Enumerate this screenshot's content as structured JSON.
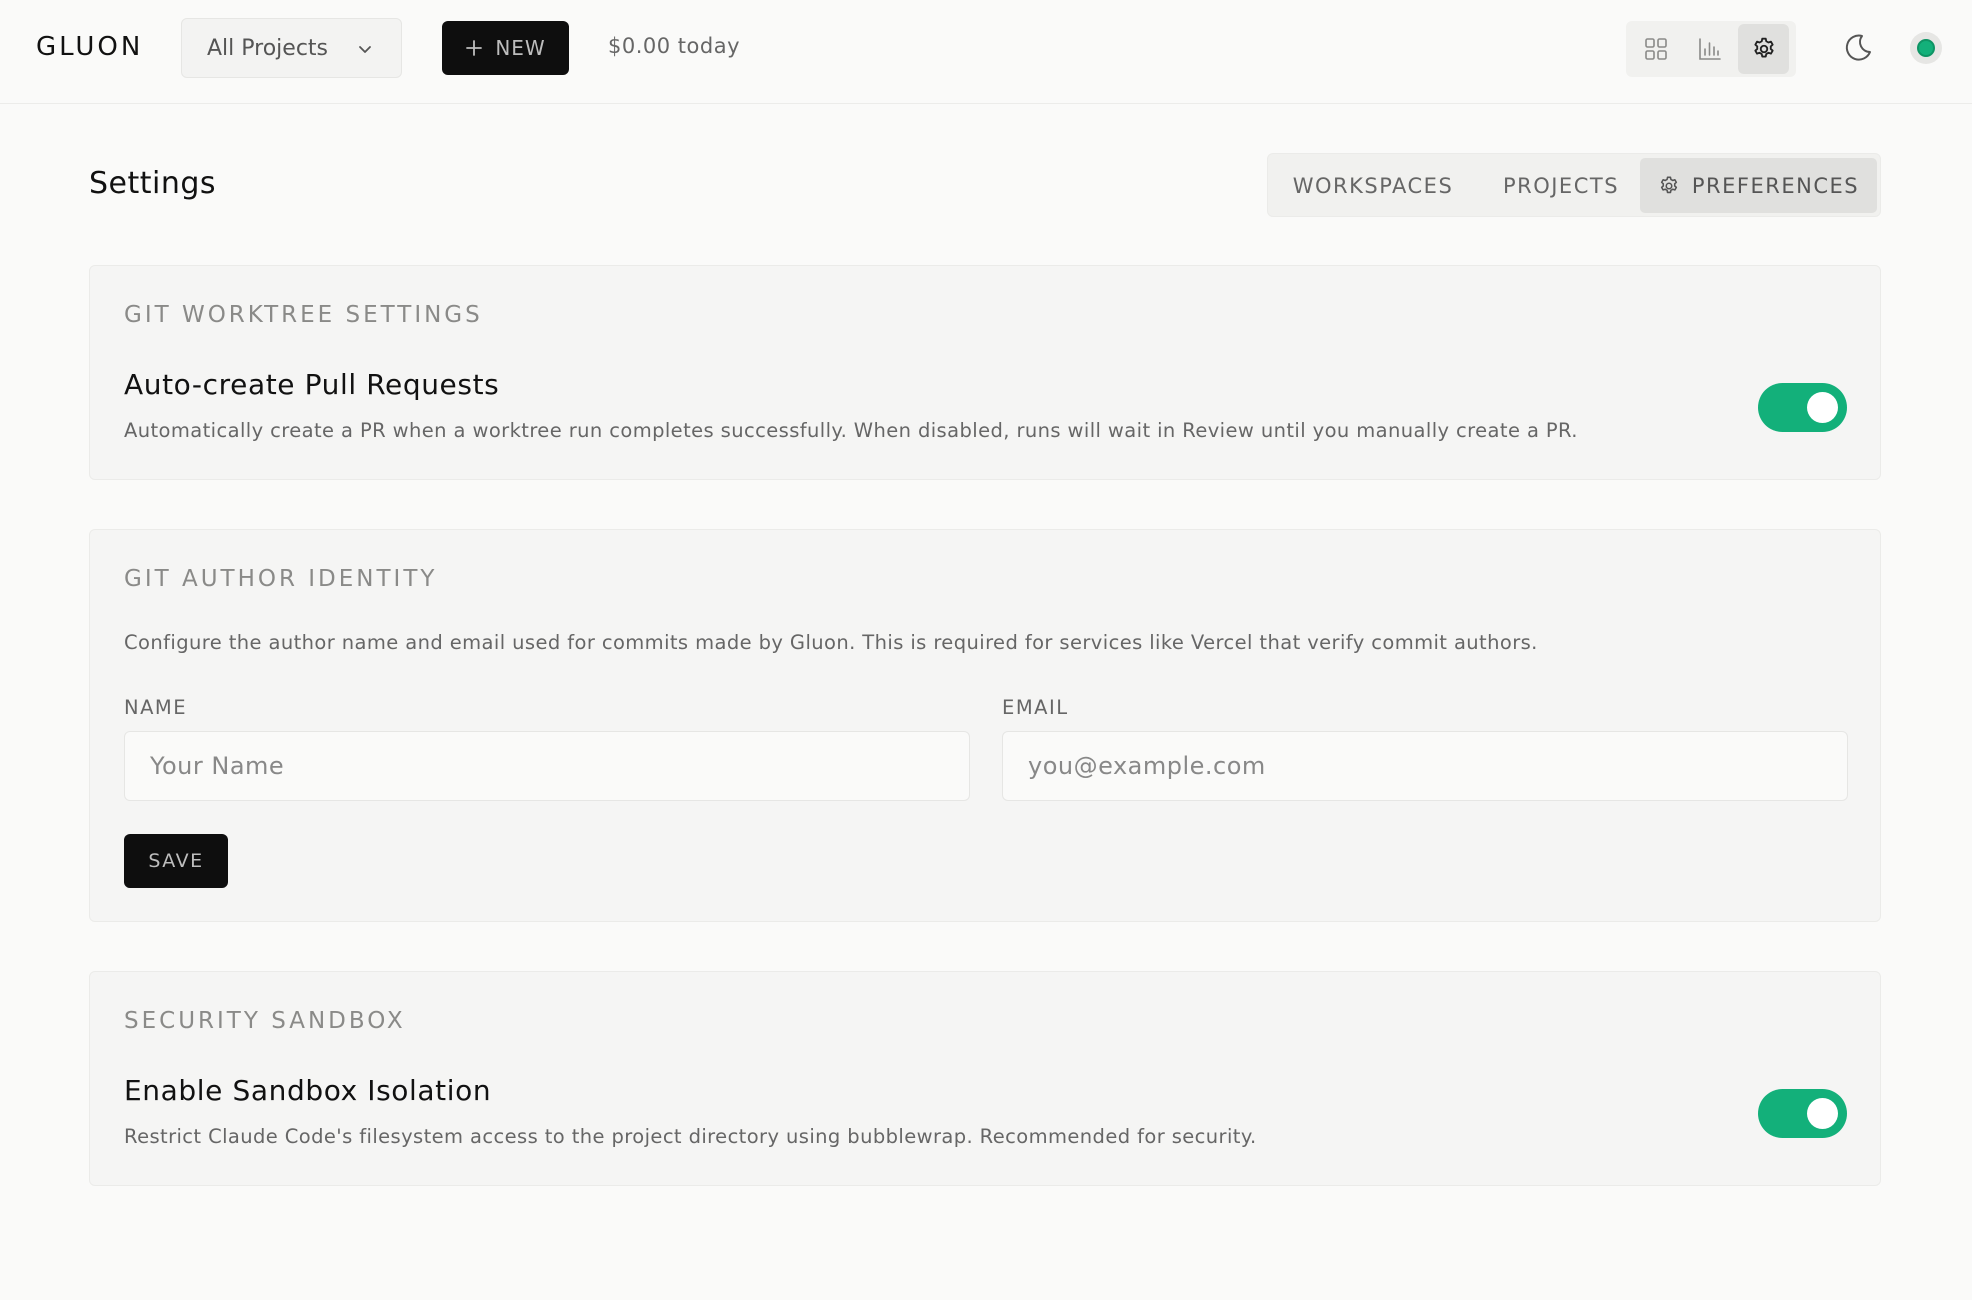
{
  "app": {
    "logo": "GLUON",
    "project_selector": "All Projects",
    "new_button": "NEW",
    "cost_today": "$0.00 today"
  },
  "icons": {
    "view_buttons": [
      "grid-icon",
      "bar-chart-icon",
      "gear-icon"
    ],
    "active_view": "gear-icon",
    "theme_toggle": "moon-icon",
    "status": "online-status-dot"
  },
  "page": {
    "title": "Settings",
    "tabs": [
      {
        "label": "WORKSPACES",
        "active": false
      },
      {
        "label": "PROJECTS",
        "active": false
      },
      {
        "label": "PREFERENCES",
        "active": true
      }
    ]
  },
  "git_worktree": {
    "section": "GIT WORKTREE SETTINGS",
    "title": "Auto-create Pull Requests",
    "description": "Automatically create a PR when a worktree run completes successfully. When disabled, runs will wait in Review until you manually create a PR.",
    "enabled": true
  },
  "git_author": {
    "section": "GIT AUTHOR IDENTITY",
    "description": "Configure the author name and email used for commits made by Gluon. This is required for services like Vercel that verify commit authors.",
    "name_label": "NAME",
    "name_placeholder": "Your Name",
    "name_value": "",
    "email_label": "EMAIL",
    "email_placeholder": "you@example.com",
    "email_value": "",
    "save_label": "SAVE"
  },
  "security": {
    "section": "SECURITY SANDBOX",
    "title": "Enable Sandbox Isolation",
    "description": "Restrict Claude Code's filesystem access to the project directory using bubblewrap. Recommended for security.",
    "enabled": true
  },
  "colors": {
    "accent_green": "#13b07a",
    "button_dark": "#0e0e0e",
    "background": "#fafaf9",
    "card": "#f5f5f4"
  }
}
